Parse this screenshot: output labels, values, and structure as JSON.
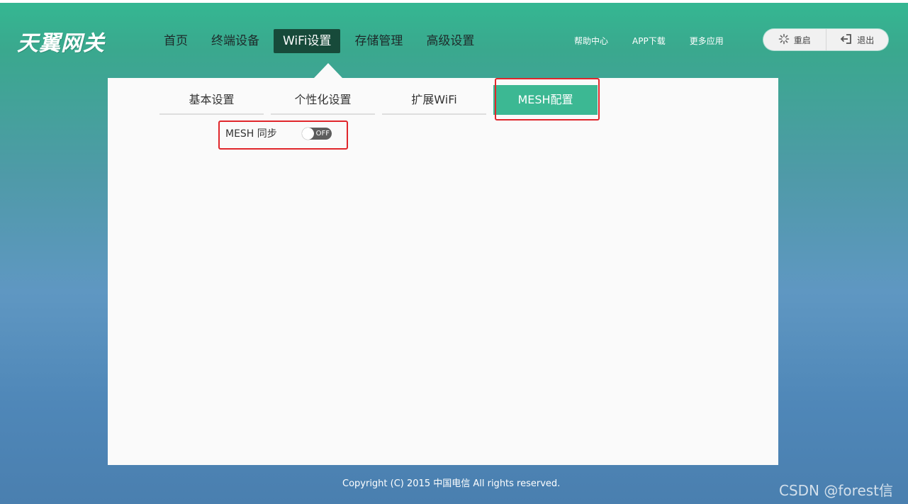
{
  "header": {
    "logo_text": "天翼网关",
    "nav": [
      {
        "label": "首页",
        "active": false
      },
      {
        "label": "终端设备",
        "active": false
      },
      {
        "label": "WiFi设置",
        "active": true
      },
      {
        "label": "存储管理",
        "active": false
      },
      {
        "label": "高级设置",
        "active": false
      }
    ],
    "links": [
      "帮助中心",
      "APP下载",
      "更多应用"
    ],
    "actions": {
      "restart_label": "重启",
      "restart_icon": "spinner-icon",
      "logout_label": "退出",
      "logout_icon": "logout-icon"
    }
  },
  "panel": {
    "tabs": [
      {
        "label": "基本设置",
        "active": false
      },
      {
        "label": "个性化设置",
        "active": false
      },
      {
        "label": "扩展WiFi",
        "active": false
      },
      {
        "label": "MESH配置",
        "active": true
      }
    ],
    "mesh_sync": {
      "label": "MESH 同步",
      "toggle_text": "OFF",
      "state": "off"
    }
  },
  "footer": {
    "copyright": "Copyright (C) 2015 中国电信 All rights reserved."
  },
  "watermark": "CSDN @forest信",
  "colors": {
    "accent": "#3cb893",
    "nav_active": "#174a3a",
    "highlight_border": "#e0262b",
    "panel_bg": "#fafafa"
  }
}
